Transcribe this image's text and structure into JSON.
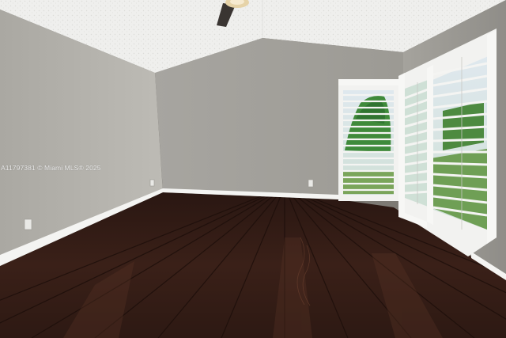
{
  "photo": {
    "watermark": "A11797381 © Miami MLS® 2025"
  },
  "colors": {
    "ceiling": "#efefed",
    "wall_left": "#b3b1ab",
    "wall_back": "#a4a29d",
    "wall_right": "#a09e98",
    "baseboard": "#f4f4f2",
    "floor_dark": "#2b1812",
    "floor_mid": "#3d2219",
    "window_frame": "#f2f2f0",
    "foliage": "#3f8a3a"
  }
}
